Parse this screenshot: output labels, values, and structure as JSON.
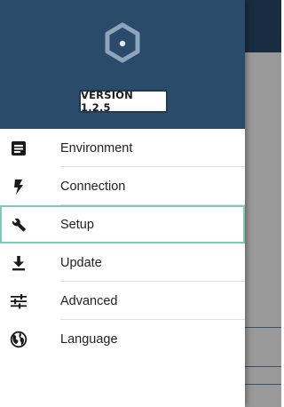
{
  "drawer": {
    "version_label": "VERSION 1.2.5",
    "items": [
      {
        "label": "Environment",
        "icon": "document-icon"
      },
      {
        "label": "Connection",
        "icon": "flash-icon"
      },
      {
        "label": "Setup",
        "icon": "wrench-icon",
        "selected": true
      },
      {
        "label": "Update",
        "icon": "download-icon"
      },
      {
        "label": "Advanced",
        "icon": "sliders-icon"
      },
      {
        "label": "Language",
        "icon": "globe-icon"
      }
    ]
  },
  "colors": {
    "header": "#2b4b6b",
    "selection_outline": "#7ec9bd",
    "scrim": "rgba(0,0,0,0.40)"
  }
}
